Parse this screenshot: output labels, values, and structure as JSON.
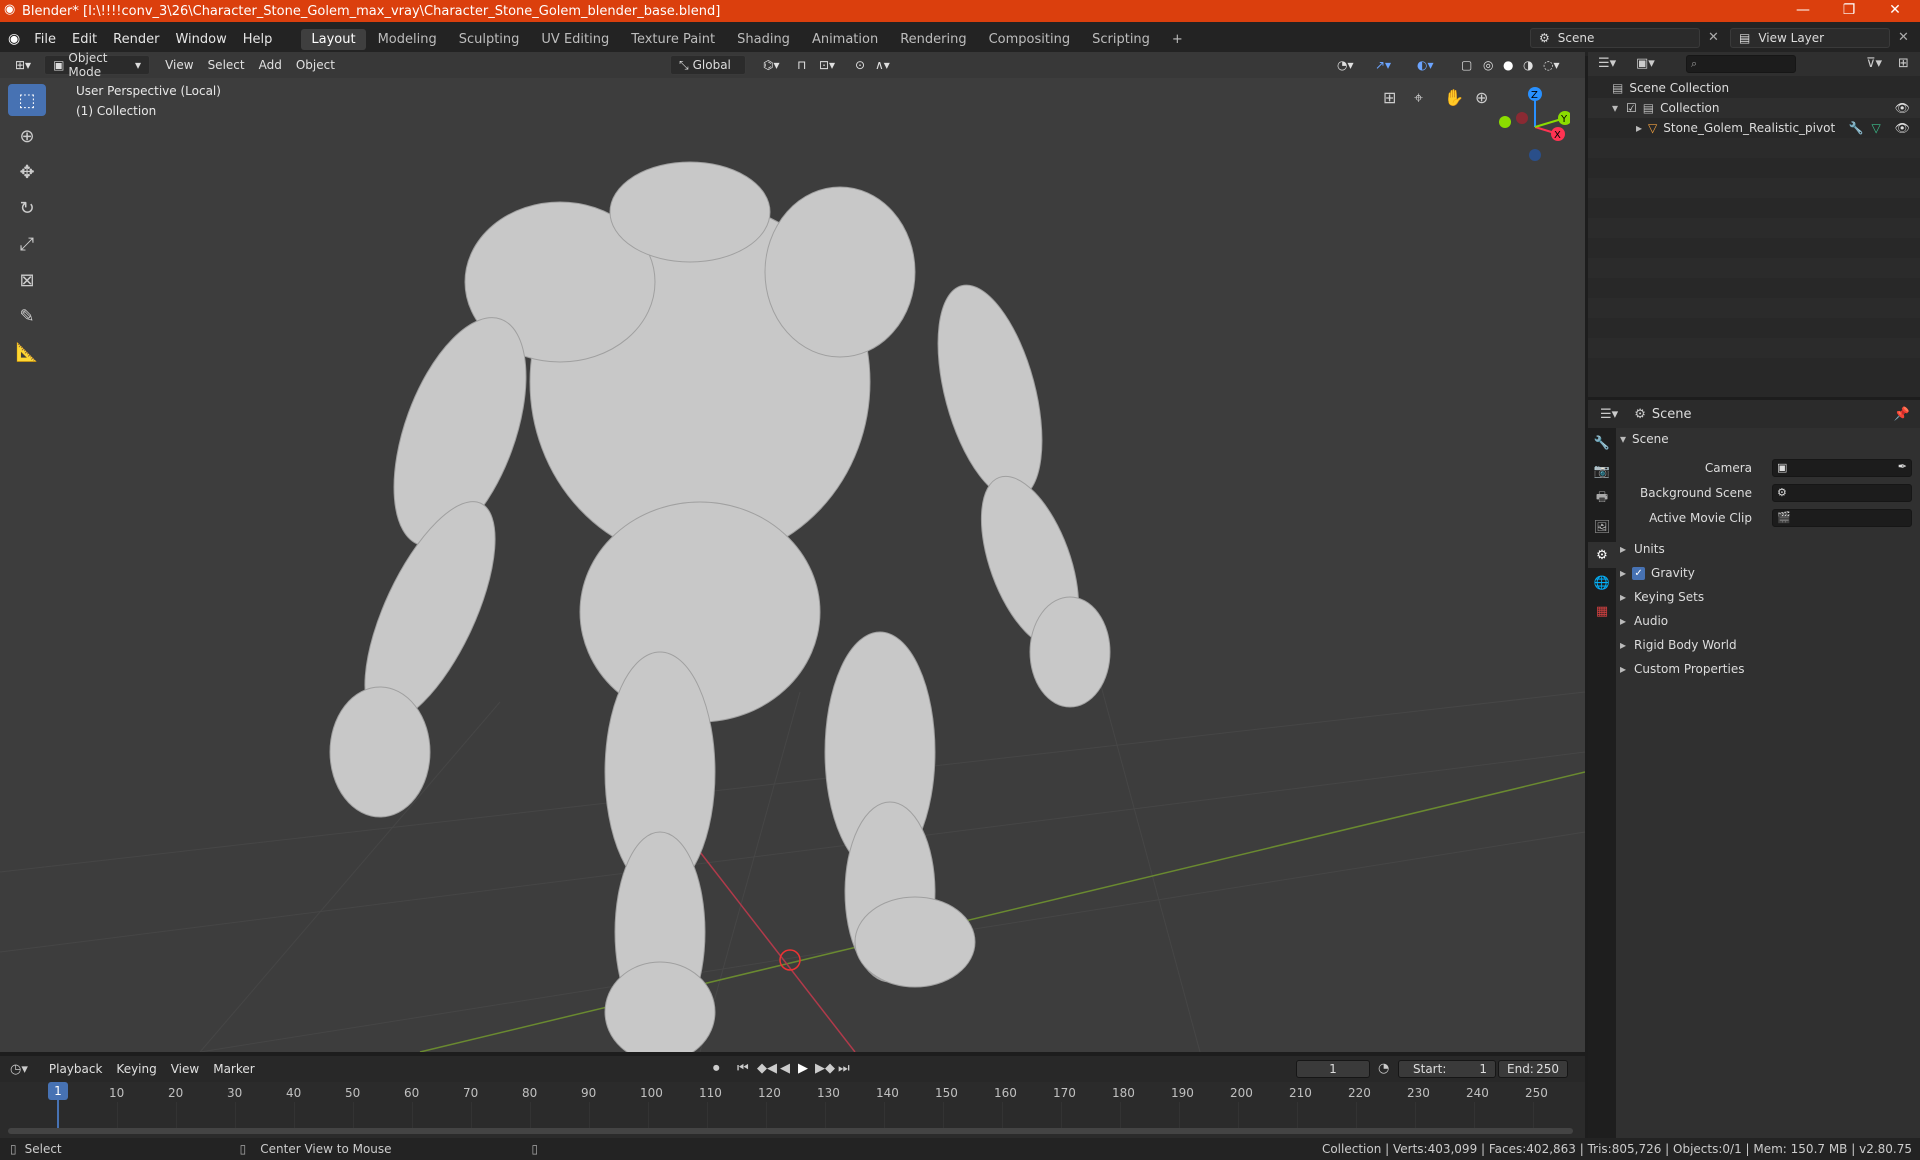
{
  "window": {
    "title": "Blender* [I:\\!!!!conv_3\\26\\Character_Stone_Golem_max_vray\\Character_Stone_Golem_blender_base.blend]",
    "minimize": "—",
    "maximize": "❐",
    "close": "✕"
  },
  "menu": {
    "items": [
      "File",
      "Edit",
      "Render",
      "Window",
      "Help"
    ],
    "workspaces": [
      "Layout",
      "Modeling",
      "Sculpting",
      "UV Editing",
      "Texture Paint",
      "Shading",
      "Animation",
      "Rendering",
      "Compositing",
      "Scripting"
    ],
    "active_workspace": "Layout",
    "add_workspace": "+",
    "scene_name": "Scene",
    "view_layer": "View Layer"
  },
  "viewport_header": {
    "mode": "Object Mode",
    "menus": [
      "View",
      "Select",
      "Add",
      "Object"
    ],
    "orientation": "Global"
  },
  "viewport": {
    "perspective": "User Perspective (Local)",
    "collection": "(1) Collection",
    "gizmo": {
      "x": "X",
      "y": "Y",
      "z": "Z"
    }
  },
  "outliner": {
    "search_placeholder": "",
    "scene_collection": "Scene Collection",
    "collection": "Collection",
    "object": "Stone_Golem_Realistic_pivot"
  },
  "properties": {
    "context": "Scene",
    "section": "Scene",
    "camera_label": "Camera",
    "background_scene_label": "Background Scene",
    "active_movie_clip_label": "Active Movie Clip",
    "panels": [
      "Units",
      "Gravity",
      "Keying Sets",
      "Audio",
      "Rigid Body World",
      "Custom Properties"
    ],
    "gravity_checked": true
  },
  "timeline": {
    "menus": [
      "Playback",
      "Keying",
      "View",
      "Marker"
    ],
    "current_frame": "1",
    "start_label": "Start:",
    "start": "1",
    "end_label": "End:",
    "end": "250",
    "ruler": [
      "10",
      "20",
      "30",
      "40",
      "50",
      "60",
      "70",
      "80",
      "90",
      "100",
      "110",
      "120",
      "130",
      "140",
      "150",
      "160",
      "170",
      "180",
      "190",
      "200",
      "210",
      "220",
      "230",
      "240",
      "250"
    ],
    "playhead": "1"
  },
  "statusbar": {
    "left_action": "Select",
    "middle_action": "Center View to Mouse",
    "stats": "Collection | Verts:403,099 | Faces:402,863 | Tris:805,726 | Objects:0/1 | Mem: 150.7 MB | v2.80.75"
  },
  "colors": {
    "titlebar": "#db3f0d",
    "accent": "#4772b3",
    "x_axis": "#ff3352",
    "y_axis": "#8bdc00",
    "z_axis": "#2890ff"
  }
}
